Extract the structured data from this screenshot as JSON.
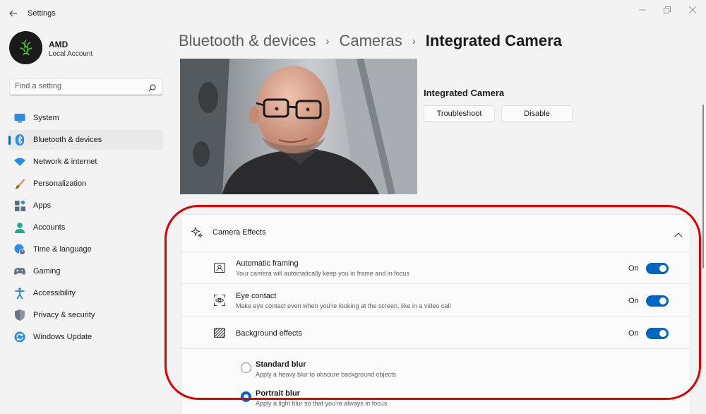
{
  "window": {
    "title": "Settings",
    "controls": [
      "minimize",
      "restore",
      "close"
    ]
  },
  "account": {
    "name": "AMD",
    "type": "Local Account"
  },
  "search": {
    "placeholder": "Find a setting"
  },
  "sidebar": {
    "items": [
      {
        "label": "System",
        "icon": "system-icon",
        "active": false
      },
      {
        "label": "Bluetooth & devices",
        "icon": "bluetooth-icon",
        "active": true
      },
      {
        "label": "Network & internet",
        "icon": "wifi-icon",
        "active": false
      },
      {
        "label": "Personalization",
        "icon": "brush-icon",
        "active": false
      },
      {
        "label": "Apps",
        "icon": "apps-icon",
        "active": false
      },
      {
        "label": "Accounts",
        "icon": "person-icon",
        "active": false
      },
      {
        "label": "Time & language",
        "icon": "globe-clock-icon",
        "active": false
      },
      {
        "label": "Gaming",
        "icon": "controller-icon",
        "active": false
      },
      {
        "label": "Accessibility",
        "icon": "accessibility-icon",
        "active": false
      },
      {
        "label": "Privacy & security",
        "icon": "shield-icon",
        "active": false
      },
      {
        "label": "Windows Update",
        "icon": "update-icon",
        "active": false
      }
    ]
  },
  "breadcrumb": {
    "items": [
      "Bluetooth & devices",
      "Cameras",
      "Integrated Camera"
    ],
    "separator": "›"
  },
  "camera": {
    "name": "Integrated Camera",
    "troubleshoot_label": "Troubleshoot",
    "disable_label": "Disable"
  },
  "effects": {
    "header": "Camera Effects",
    "rows": [
      {
        "title": "Automatic framing",
        "subtitle": "Your camera will automatically keep you in frame and in focus",
        "state": "On"
      },
      {
        "title": "Eye contact",
        "subtitle": "Make eye contact even when you're looking at the screen, like in a video call",
        "state": "On"
      },
      {
        "title": "Background effects",
        "subtitle": "",
        "state": "On"
      }
    ],
    "background_options": [
      {
        "title": "Standard blur",
        "subtitle": "Apply a heavy blur to obscure background objects",
        "selected": false
      },
      {
        "title": "Portrait blur",
        "subtitle": "Apply a light blur so that you're always in focus",
        "selected": true
      }
    ]
  },
  "colors": {
    "accent": "#0067c0",
    "annotation": "#e00000"
  }
}
